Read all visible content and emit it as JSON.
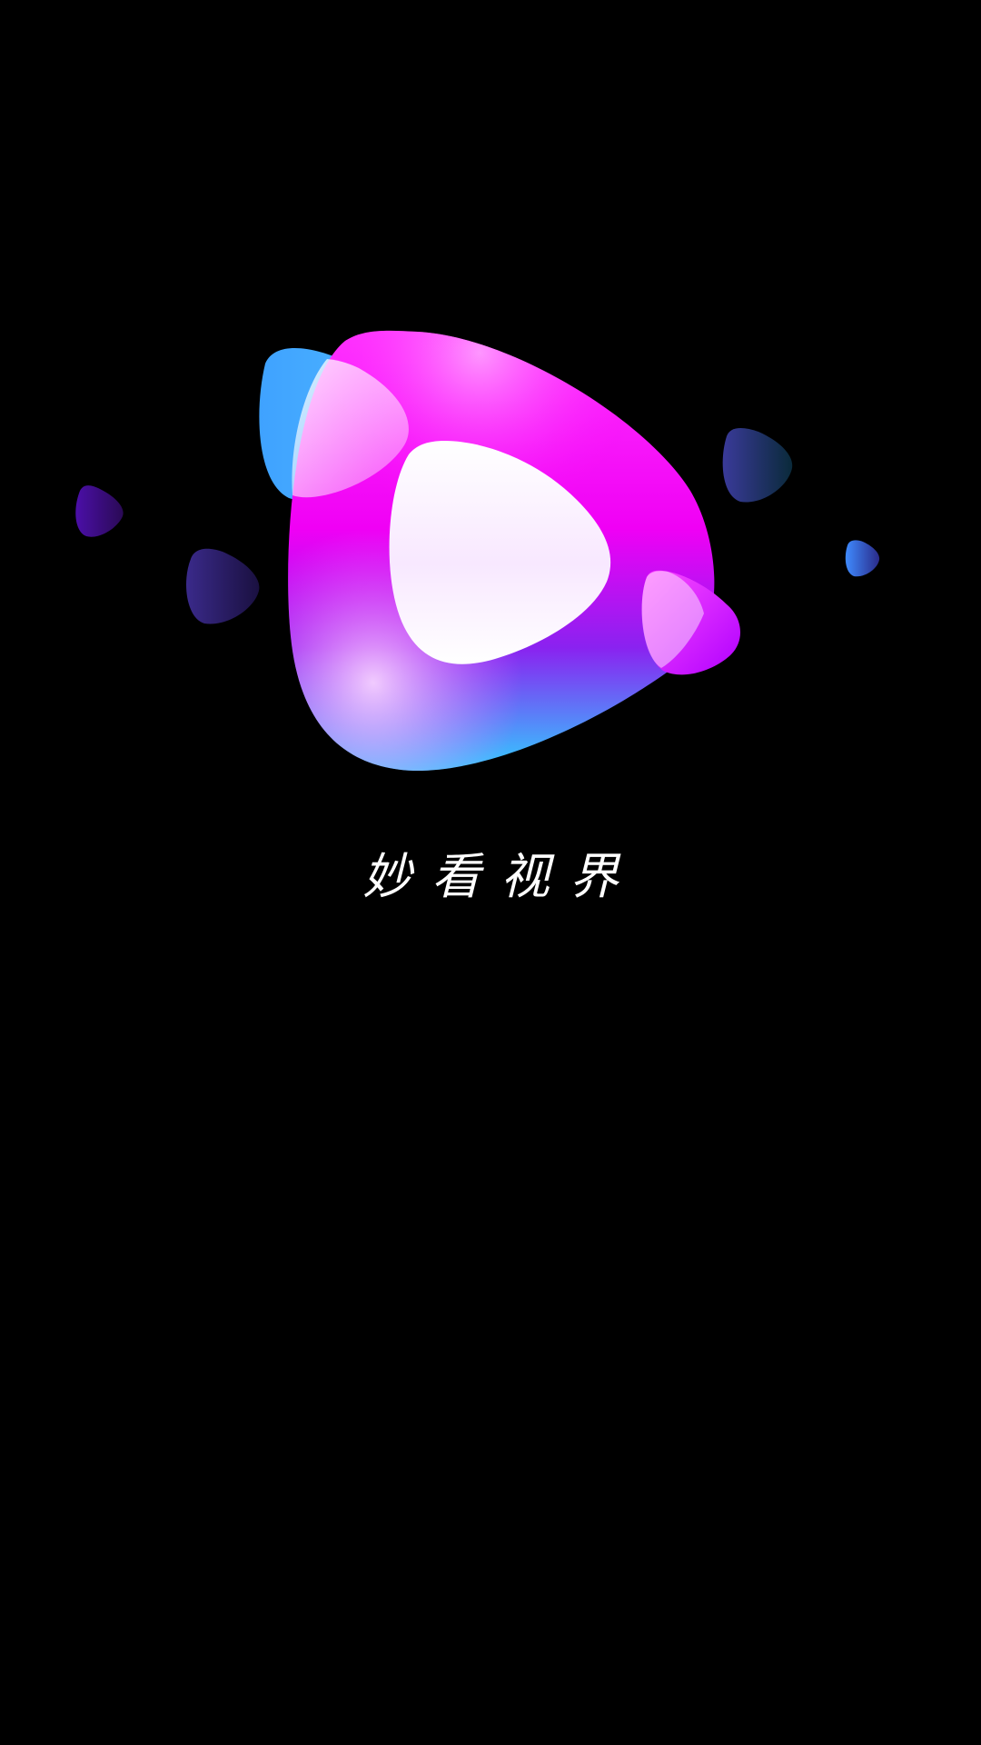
{
  "splash": {
    "slogan": "妙看视界"
  },
  "logo": {
    "icon": "play-blob-icon",
    "colors": {
      "magenta": "#ff00ff",
      "violet": "#8a2be2",
      "blue": "#3fa2ff",
      "cyan": "#3fd8ff",
      "white": "#ffffff",
      "background": "#000000"
    }
  }
}
